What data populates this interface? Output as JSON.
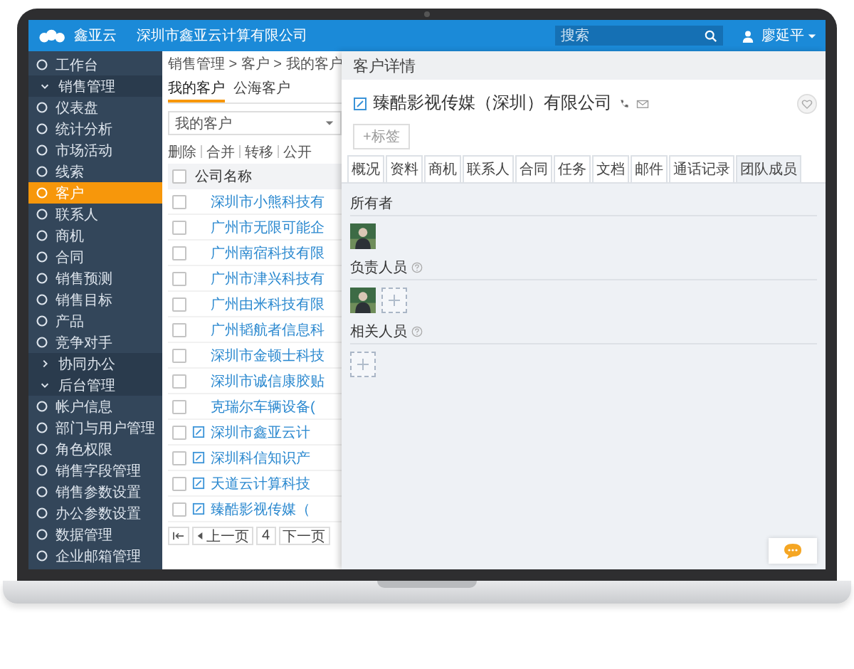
{
  "topbar": {
    "logo": "鑫亚云",
    "company": "深圳市鑫亚云计算有限公司",
    "search": {
      "placeholder": "搜索"
    },
    "user": "廖延平"
  },
  "sidebar": {
    "items": [
      {
        "kind": "item",
        "label": "工作台",
        "selected": false
      },
      {
        "kind": "group",
        "label": "销售管理",
        "expanded": true,
        "children": [
          {
            "kind": "item",
            "label": "仪表盘",
            "selected": false
          },
          {
            "kind": "item",
            "label": "统计分析",
            "selected": false
          },
          {
            "kind": "item",
            "label": "市场活动",
            "selected": false
          },
          {
            "kind": "item",
            "label": "线索",
            "selected": false
          },
          {
            "kind": "item",
            "label": "客户",
            "selected": true
          },
          {
            "kind": "item",
            "label": "联系人",
            "selected": false
          },
          {
            "kind": "item",
            "label": "商机",
            "selected": false
          },
          {
            "kind": "item",
            "label": "合同",
            "selected": false
          },
          {
            "kind": "item",
            "label": "销售预测",
            "selected": false
          },
          {
            "kind": "item",
            "label": "销售目标",
            "selected": false
          },
          {
            "kind": "item",
            "label": "产品",
            "selected": false
          },
          {
            "kind": "item",
            "label": "竞争对手",
            "selected": false
          }
        ]
      },
      {
        "kind": "group",
        "label": "协同办公",
        "expanded": false
      },
      {
        "kind": "group",
        "label": "后台管理",
        "expanded": true,
        "children": [
          {
            "kind": "item",
            "label": "帐户信息",
            "selected": false
          },
          {
            "kind": "item",
            "label": "部门与用户管理",
            "selected": false
          },
          {
            "kind": "item",
            "label": "角色权限",
            "selected": false
          },
          {
            "kind": "item",
            "label": "销售字段管理",
            "selected": false
          },
          {
            "kind": "item",
            "label": "销售参数设置",
            "selected": false
          },
          {
            "kind": "item",
            "label": "办公参数设置",
            "selected": false
          },
          {
            "kind": "item",
            "label": "数据管理",
            "selected": false
          },
          {
            "kind": "item",
            "label": "企业邮箱管理",
            "selected": false
          }
        ]
      }
    ]
  },
  "list": {
    "breadcrumb": "销售管理 > 客户 > 我的客户",
    "tabs": [
      {
        "label": "我的客户",
        "selected": true
      },
      {
        "label": "公海客户",
        "selected": false
      }
    ],
    "filter": "我的客户",
    "actions": [
      "删除",
      "合并",
      "转移",
      "公开"
    ],
    "column": "公司名称",
    "all_checked": false,
    "rows": [
      {
        "name": "深圳市小熊科技有",
        "icon": false,
        "checked": false
      },
      {
        "name": "广州市无限可能企",
        "icon": false,
        "checked": false
      },
      {
        "name": "广州南宿科技有限",
        "icon": false,
        "checked": false
      },
      {
        "name": "广州市津兴科技有",
        "icon": false,
        "checked": false
      },
      {
        "name": "广州由米科技有限",
        "icon": false,
        "checked": false
      },
      {
        "name": "广州韬航者信息科",
        "icon": false,
        "checked": false
      },
      {
        "name": "深圳市金顿士科技",
        "icon": false,
        "checked": false
      },
      {
        "name": "深圳市诚信康胶贴",
        "icon": false,
        "checked": false
      },
      {
        "name": "克瑞尔车辆设备(",
        "icon": false,
        "checked": false
      },
      {
        "name": "深圳市鑫亚云计",
        "icon": true,
        "checked": false
      },
      {
        "name": "深圳科信知识产",
        "icon": true,
        "checked": false
      },
      {
        "name": "天道云计算科技",
        "icon": true,
        "checked": false
      },
      {
        "name": "臻酷影视传媒（",
        "icon": true,
        "checked": false
      }
    ],
    "pager": {
      "prev": "上一页",
      "page": "4",
      "next": "下一页"
    }
  },
  "detail": {
    "header": "客户详情",
    "title": "臻酷影视传媒（深圳）有限公司",
    "tag_button": "+标签",
    "tabs": [
      {
        "label": "概况",
        "selected": false
      },
      {
        "label": "资料",
        "selected": false
      },
      {
        "label": "商机",
        "selected": false
      },
      {
        "label": "联系人",
        "selected": false
      },
      {
        "label": "合同",
        "selected": false
      },
      {
        "label": "任务",
        "selected": false
      },
      {
        "label": "文档",
        "selected": false
      },
      {
        "label": "邮件",
        "selected": false
      },
      {
        "label": "通话记录",
        "selected": false
      },
      {
        "label": "团队成员",
        "selected": true
      }
    ],
    "sections": [
      {
        "title": "所有者",
        "help": false,
        "entries": [
          {
            "kind": "person"
          }
        ]
      },
      {
        "title": "负责人员",
        "help": true,
        "entries": [
          {
            "kind": "person"
          },
          {
            "kind": "add"
          }
        ]
      },
      {
        "title": "相关人员",
        "help": true,
        "entries": [
          {
            "kind": "add"
          }
        ]
      }
    ]
  }
}
